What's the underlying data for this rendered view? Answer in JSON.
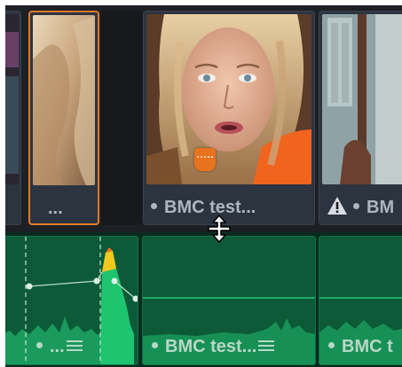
{
  "video_track": {
    "clips": [
      {
        "label": "",
        "selected": false
      },
      {
        "label": "...",
        "selected": true
      },
      {
        "label": "BMC test...",
        "selected": false,
        "has_marker": true
      },
      {
        "label": "BM",
        "selected": false,
        "has_warning": true
      }
    ]
  },
  "audio_track": {
    "clips": [
      {
        "label": "..."
      },
      {
        "label": "BMC test..."
      },
      {
        "label": "BMC t"
      }
    ]
  },
  "colors": {
    "selection": "#e07a2a",
    "marker": "#e8731e",
    "audio_clip": "#0c5a38",
    "video_clip": "#2c3440"
  },
  "icons": [
    "marker-icon",
    "warning-icon",
    "trim-cursor-icon",
    "clip-menu-icon"
  ]
}
